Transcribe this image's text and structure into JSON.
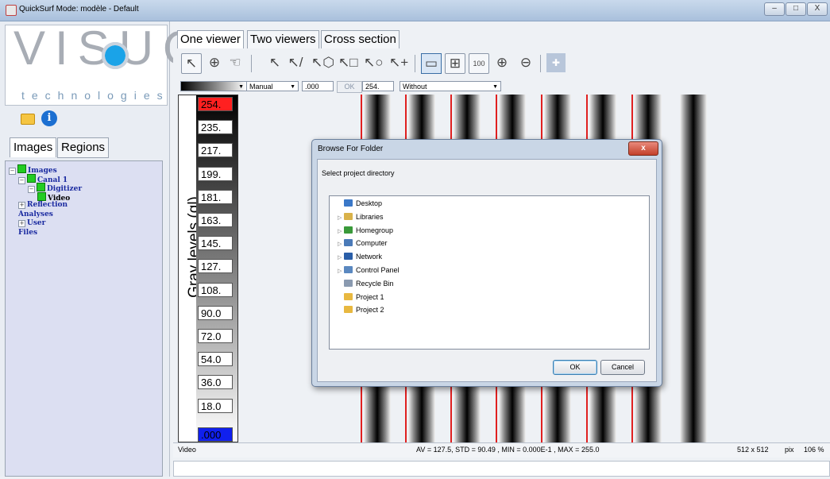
{
  "window": {
    "title": "QuickSurf Mode: modèle -  Default",
    "minimize": "–",
    "maximize": "□",
    "close": "X"
  },
  "left_panel": {
    "logo_main": "VISUOL",
    "logo_sub": "technologies",
    "tabs": [
      "Images",
      "Regions"
    ],
    "tree": [
      {
        "label": "Images",
        "level": 0,
        "expander": "−",
        "checkbox": true
      },
      {
        "label": "Canal 1",
        "level": 1,
        "expander": "−",
        "checkbox": true
      },
      {
        "label": "Digitizer",
        "level": 2,
        "expander": "−",
        "checkbox": true
      },
      {
        "label": "Video",
        "level": 3,
        "expander": "",
        "checkbox": true
      },
      {
        "label": "Reflection",
        "level": 1,
        "expander": "+",
        "checkbox": false
      },
      {
        "label": "Analyses",
        "level": 1,
        "expander": "",
        "checkbox": false
      },
      {
        "label": "User",
        "level": 1,
        "expander": "+",
        "checkbox": false
      },
      {
        "label": "Files",
        "level": 1,
        "expander": "",
        "checkbox": false
      }
    ]
  },
  "main": {
    "tabs": [
      "One viewer",
      "Two viewers",
      "Cross section"
    ],
    "toolbar_icons": [
      "pointer-icon",
      "info-probe-icon",
      "hand-pan-icon",
      "select-point-icon",
      "select-line-icon",
      "select-polygon-icon",
      "select-rectangle-icon",
      "select-ellipse-icon",
      "select-add-icon",
      "fit-window-icon",
      "fit-full-icon",
      "zoom-100-icon",
      "zoom-in-icon",
      "zoom-out-icon",
      "crosshair-icon"
    ],
    "zoom_100_label": "100",
    "controls": {
      "mode": "Manual",
      "min_value": ".000",
      "ok_label": "OK",
      "max_value": "254.",
      "palette": "Without"
    },
    "scale": {
      "title": "Gray levels (gl)",
      "ticks": [
        "254.",
        "235.",
        "217.",
        "199.",
        "181.",
        "163.",
        "145.",
        "127.",
        "108.",
        "90.0",
        "72.0",
        "54.0",
        "36.0",
        "18.0",
        ".000"
      ]
    },
    "status": {
      "left": "Video",
      "stats": "AV = 127.5, STD = 90.49 , MIN = 0.000E-1 , MAX = 255.0",
      "size": "512 x 512",
      "unit": "pix",
      "zoom": "106 %"
    }
  },
  "dialog": {
    "title": "Browse For Folder",
    "close": "x",
    "prompt": "Select project directory",
    "items": [
      {
        "label": "Desktop",
        "expander": "",
        "icon": "desktop-icon",
        "color": "#3a78c8"
      },
      {
        "label": "Libraries",
        "expander": "▷",
        "icon": "libraries-icon",
        "color": "#d9b24a"
      },
      {
        "label": "Homegroup",
        "expander": "▷",
        "icon": "homegroup-icon",
        "color": "#3a9a3a"
      },
      {
        "label": "Computer",
        "expander": "▷",
        "icon": "computer-icon",
        "color": "#4a7ab8"
      },
      {
        "label": "Network",
        "expander": "▷",
        "icon": "network-icon",
        "color": "#2a5ea8"
      },
      {
        "label": "Control Panel",
        "expander": "▷",
        "icon": "control-panel-icon",
        "color": "#5a88c0"
      },
      {
        "label": "Recycle Bin",
        "expander": "",
        "icon": "recycle-bin-icon",
        "color": "#8a9ab0"
      },
      {
        "label": "Project 1",
        "expander": "",
        "icon": "folder-icon",
        "color": "#e8b840"
      },
      {
        "label": "Project 2",
        "expander": "",
        "icon": "folder-icon",
        "color": "#e8b840"
      }
    ],
    "ok_label": "OK",
    "cancel_label": "Cancel"
  }
}
